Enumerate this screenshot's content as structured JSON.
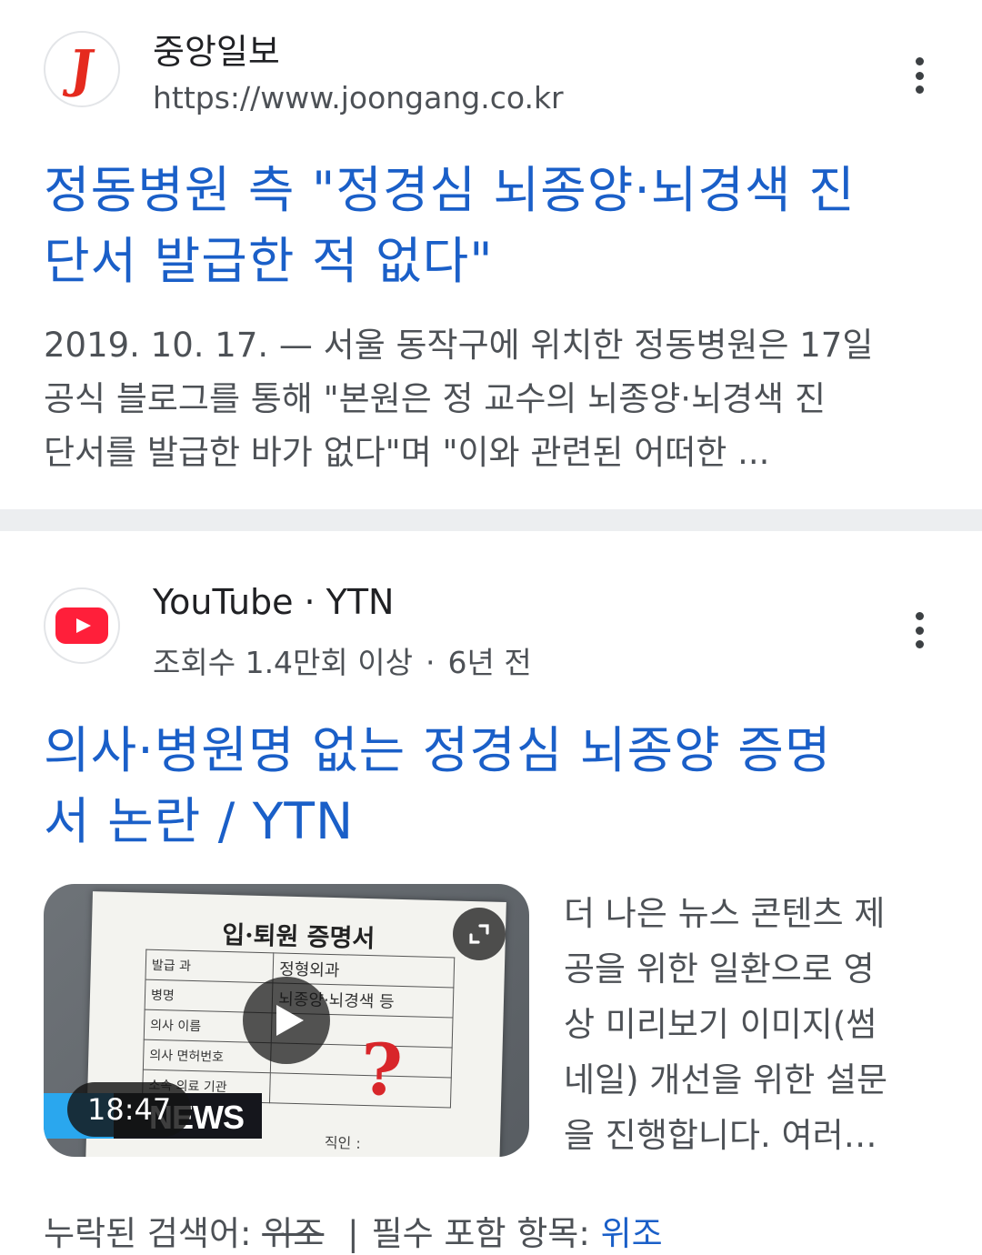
{
  "result1": {
    "site_name": "중앙일보",
    "url": "https://www.joongang.co.kr",
    "favicon_letter": "J",
    "title_line1": "정동병원 측 \"정경심 뇌종양·뇌경색 진",
    "title_line2": "단서 발급한 적 없다\"",
    "snippet_line1": "2019. 10. 17. — 서울 동작구에 위치한 정동병원은 17일",
    "snippet_line2": "공식 블로그를 통해 \"본원은 정 교수의 뇌종양·뇌경색 진",
    "snippet_line3": "단서를 발급한 바가 없다\"며 \"이와 관련된 어떠한 ..."
  },
  "result2": {
    "source": "YouTube",
    "channel": "YTN",
    "separator": "·",
    "views": "조회수 1.4만회 이상",
    "age": "6년 전",
    "title_line1": "의사·병원명 없는 정경심 뇌종양 증명",
    "title_line2": "서 논란 / YTN",
    "thumbnail": {
      "doc_title": "입·퇴원 증명서",
      "rows": [
        {
          "label": "발급 과",
          "value": "정형외과"
        },
        {
          "label": "병명",
          "value": "뇌종양·뇌경색 등"
        },
        {
          "label": "의사 이름",
          "value": ""
        },
        {
          "label": "의사 면허번호",
          "value": ""
        },
        {
          "label": "소속 의료 기관",
          "value": ""
        },
        {
          "label": "",
          "value": "직인 :"
        }
      ],
      "question_mark": "?",
      "news_logo": "NEWS",
      "duration": "18:47"
    },
    "desc_line1": "더 나은 뉴스 콘텐츠 제",
    "desc_line2": "공을 위한 일환으로 영",
    "desc_line3": "상 미리보기 이미지(썸",
    "desc_line4": "네일) 개선을 위한 설문",
    "desc_line5": "을 진행합니다. 여러…",
    "missing_label": "누락된 검색어:",
    "missing_term": "위조",
    "missing_sep": "|",
    "must_include_label": "필수 포함 항목:",
    "must_include_term": "위조"
  },
  "icons": {
    "more": "more-vert-icon",
    "play": "play-icon",
    "expand": "expand-icon"
  },
  "colors": {
    "title_link": "#1a5fc8",
    "snippet": "#4d5156",
    "divider": "#eceef0",
    "joongang_red": "#e52a1e",
    "youtube_red": "#ff1f3a"
  }
}
